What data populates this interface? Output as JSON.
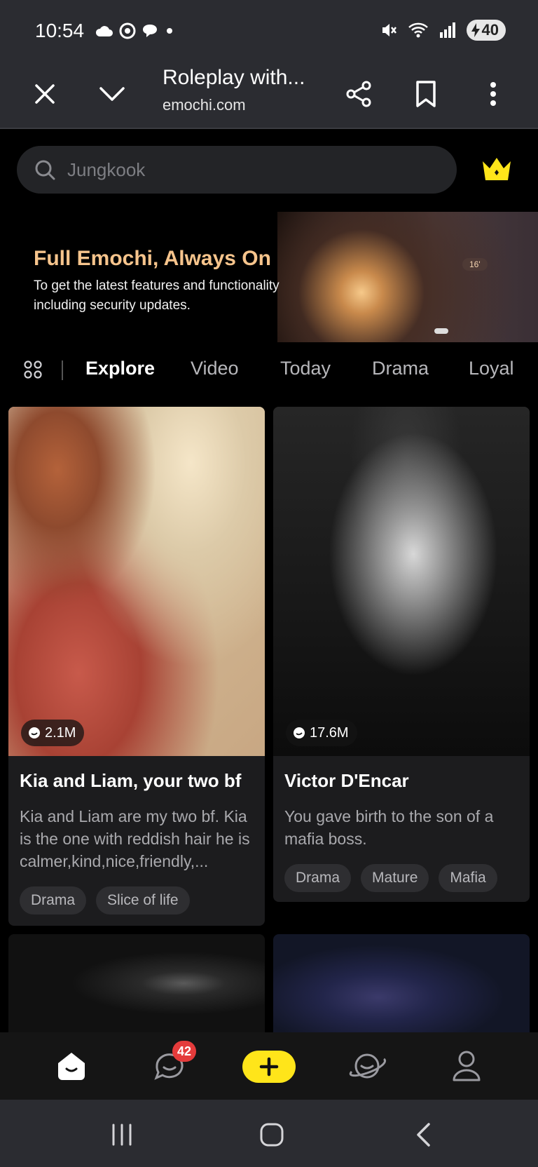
{
  "status_bar": {
    "time": "10:54",
    "battery": "40",
    "icons_left": [
      "cloud-icon",
      "chrome-icon",
      "chat-bubble-icon",
      "dot-icon"
    ],
    "icons_right": [
      "mute-icon",
      "wifi-icon",
      "signal-icon",
      "battery-icon"
    ]
  },
  "browser": {
    "page_title": "Roleplay with...",
    "url": "emochi.com"
  },
  "search": {
    "placeholder": "Jungkook"
  },
  "banner": {
    "title": "Full Emochi, Always On",
    "description": "To get the latest features and functionality including security updates.",
    "image_tag": "16'"
  },
  "tabs": [
    {
      "label": "Explore",
      "active": true
    },
    {
      "label": "Video",
      "active": false
    },
    {
      "label": "Today",
      "active": false
    },
    {
      "label": "Drama",
      "active": false
    },
    {
      "label": "Loyal",
      "active": false
    }
  ],
  "cards": [
    {
      "stat": "2.1M",
      "title": "Kia and Liam, your two bf",
      "description": "Kia and Liam are my two bf. Kia is the one with reddish hair he is calmer,kind,nice,friendly,...",
      "tags": [
        "Drama",
        "Slice of life"
      ]
    },
    {
      "stat": "17.6M",
      "title": "Victor D'Encar",
      "description": "You gave birth to the son of a mafia boss.",
      "tags": [
        "Drama",
        "Mature",
        "Mafia"
      ]
    }
  ],
  "bottom_nav": {
    "items": [
      "home-icon",
      "chat-icon",
      "create-icon",
      "discover-icon",
      "profile-icon"
    ],
    "chat_badge": "42"
  },
  "colors": {
    "accent_yellow": "#ffe51a",
    "banner_title": "#f6c48c",
    "badge_red": "#e43b3b"
  }
}
